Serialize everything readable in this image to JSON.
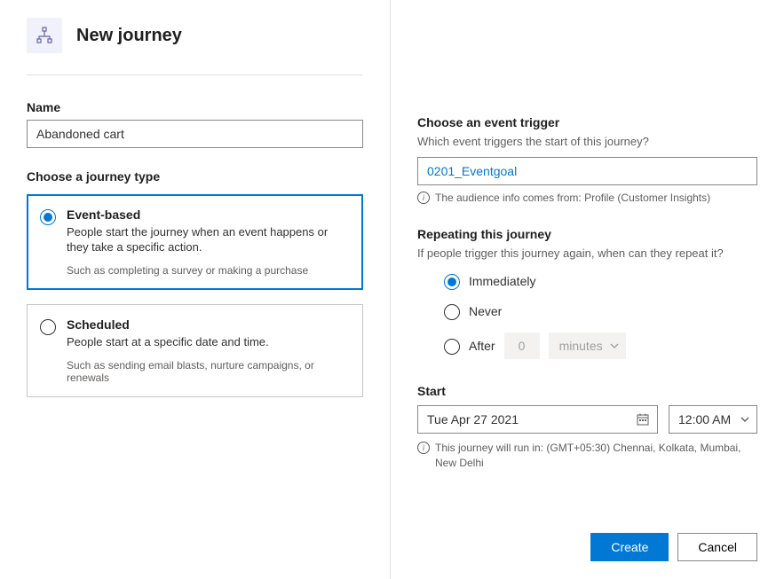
{
  "header": {
    "title": "New journey",
    "icon": "sitemap-icon"
  },
  "left": {
    "name_label": "Name",
    "name_value": "Abandoned cart",
    "journey_type_label": "Choose a journey type",
    "types": [
      {
        "title": "Event-based",
        "desc": "People start the journey when an event happens or they take a specific action.",
        "hint": "Such as completing a survey or making a purchase",
        "selected": true
      },
      {
        "title": "Scheduled",
        "desc": "People start at a specific date and time.",
        "hint": "Such as sending email blasts, nurture campaigns, or renewals",
        "selected": false
      }
    ]
  },
  "right": {
    "trigger_label": "Choose an event trigger",
    "trigger_desc": "Which event triggers the start of this journey?",
    "trigger_value": "0201_Eventgoal",
    "trigger_info": "The audience info comes from: Profile (Customer Insights)",
    "repeat_label": "Repeating this journey",
    "repeat_desc": "If people trigger this journey again, when can they repeat it?",
    "repeat_options": {
      "immediately": "Immediately",
      "never": "Never",
      "after": "After",
      "after_value": "0",
      "after_unit": "minutes"
    },
    "start_label": "Start",
    "start_date": "Tue Apr 27 2021",
    "start_time": "12:00 AM",
    "tz_info": "This journey will run in: (GMT+05:30) Chennai, Kolkata, Mumbai, New Delhi"
  },
  "footer": {
    "create_label": "Create",
    "cancel_label": "Cancel"
  }
}
